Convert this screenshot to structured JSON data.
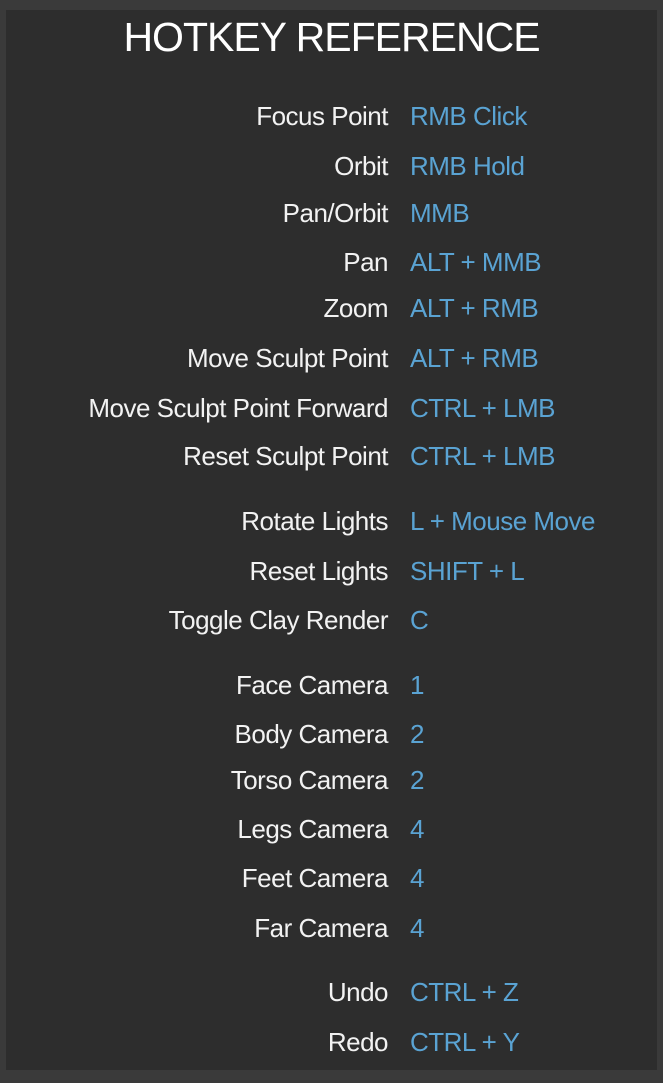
{
  "title": "HOTKEY REFERENCE",
  "accent_color": "#5aa3d3",
  "hotkeys": [
    {
      "action": "Focus Point",
      "key": "RMB Click"
    },
    {
      "action": "Orbit",
      "key": "RMB Hold"
    },
    {
      "action": "Pan/Orbit",
      "key": "MMB"
    },
    {
      "action": "Pan",
      "key": "ALT + MMB"
    },
    {
      "action": "Zoom",
      "key": "ALT + RMB"
    },
    {
      "action": "Move Sculpt Point",
      "key": "ALT + RMB"
    },
    {
      "action": "Move Sculpt Point Forward",
      "key": "CTRL + LMB"
    },
    {
      "action": "Reset Sculpt Point",
      "key": "CTRL + LMB"
    },
    {
      "action": "Rotate Lights",
      "key": "L + Mouse Move"
    },
    {
      "action": "Reset Lights",
      "key": "SHIFT + L"
    },
    {
      "action": "Toggle Clay Render",
      "key": "C"
    },
    {
      "action": "Face Camera",
      "key": "1"
    },
    {
      "action": "Body Camera",
      "key": "2"
    },
    {
      "action": "Torso Camera",
      "key": "2"
    },
    {
      "action": "Legs Camera",
      "key": "4"
    },
    {
      "action": "Feet Camera",
      "key": "4"
    },
    {
      "action": "Far Camera",
      "key": "4"
    },
    {
      "action": "Undo",
      "key": "CTRL + Z"
    },
    {
      "action": "Redo",
      "key": "CTRL + Y"
    }
  ]
}
